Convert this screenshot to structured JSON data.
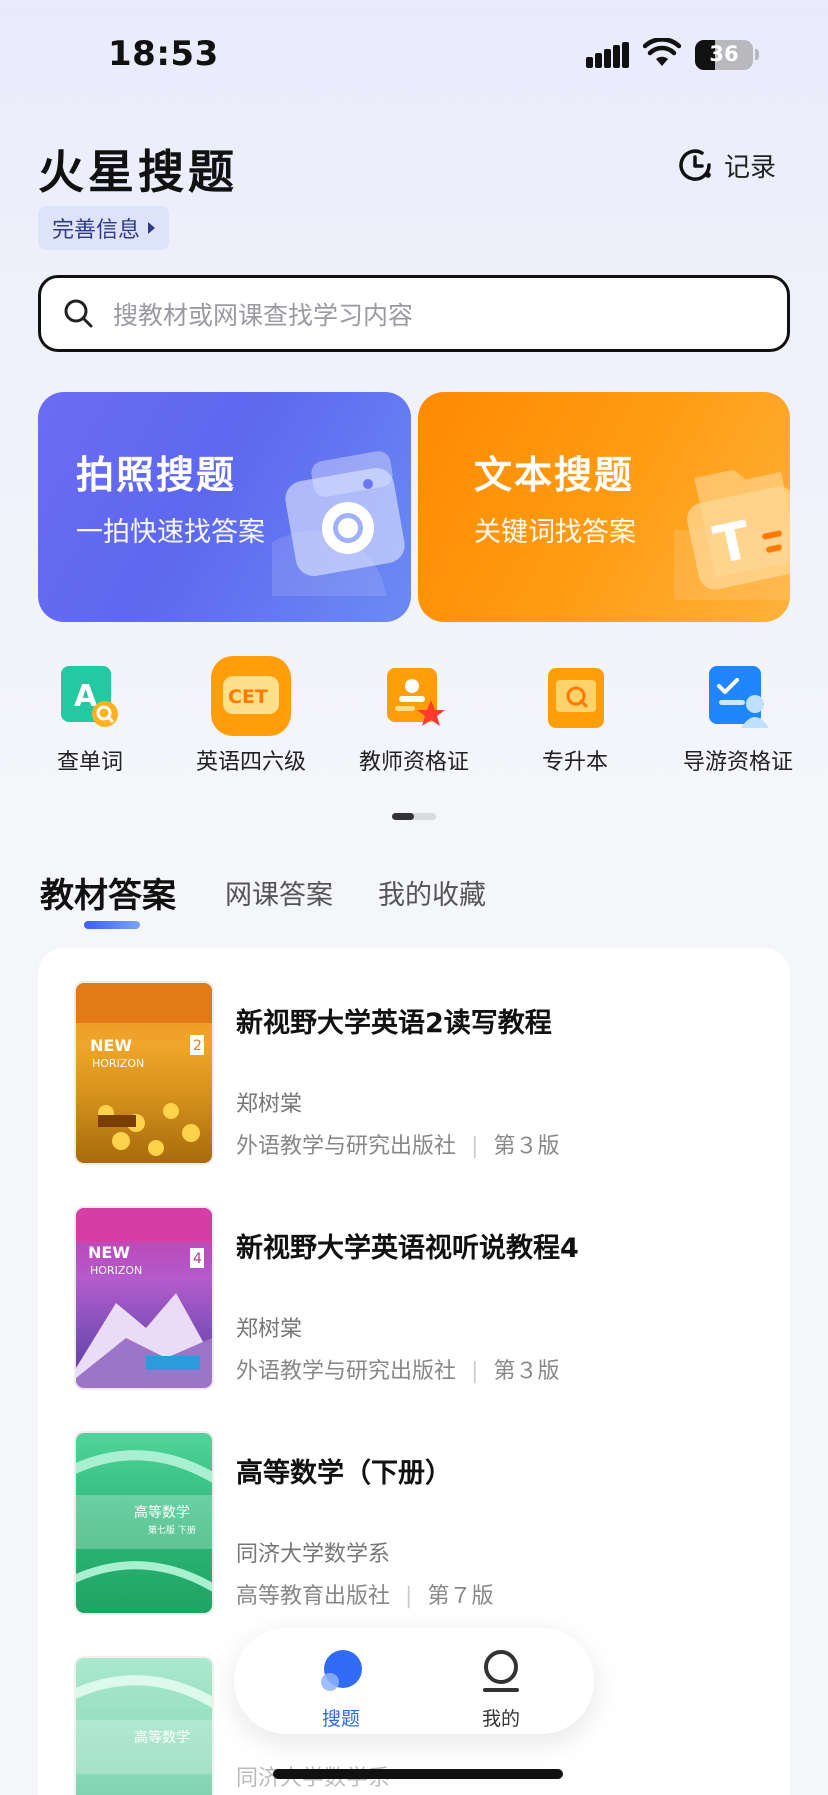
{
  "status_bar": {
    "time": "18:53",
    "battery": "36"
  },
  "header": {
    "title": "火星搜题",
    "record_label": "记录",
    "complete_info_label": "完善信息"
  },
  "search": {
    "placeholder": "搜教材或网课查找学习内容"
  },
  "cards": [
    {
      "title": "拍照搜题",
      "subtitle": "一拍快速找答案"
    },
    {
      "title": "文本搜题",
      "subtitle": "关键词找答案"
    }
  ],
  "quick_links": [
    {
      "label": "查单词",
      "icon": "word-lookup-icon"
    },
    {
      "label": "英语四六级",
      "icon": "cet-icon",
      "icon_text": "CET"
    },
    {
      "label": "教师资格证",
      "icon": "teacher-cert-icon"
    },
    {
      "label": "专升本",
      "icon": "upgrade-exam-icon"
    },
    {
      "label": "导游资格证",
      "icon": "tour-guide-cert-icon"
    }
  ],
  "tabs": [
    "教材答案",
    "网课答案",
    "我的收藏"
  ],
  "books": [
    {
      "title": "新视野大学英语2读写教程",
      "author": "郑树棠",
      "publisher": "外语教学与研究出版社",
      "edition": "第３版"
    },
    {
      "title": "新视野大学英语视听说教程4",
      "author": "郑树棠",
      "publisher": "外语教学与研究出版社",
      "edition": "第３版"
    },
    {
      "title": "高等数学（下册）",
      "author": "同济大学数学系",
      "publisher": "高等教育出版社",
      "edition": "第７版"
    },
    {
      "title": "",
      "author": "同济大学数学系",
      "publisher": "",
      "edition": ""
    }
  ],
  "bottom_nav": [
    {
      "label": "搜题"
    },
    {
      "label": "我的"
    }
  ],
  "colors": {
    "accent": "#3b5df4",
    "photo_card": "#6b6cf3",
    "text_card": "#ff9500"
  }
}
